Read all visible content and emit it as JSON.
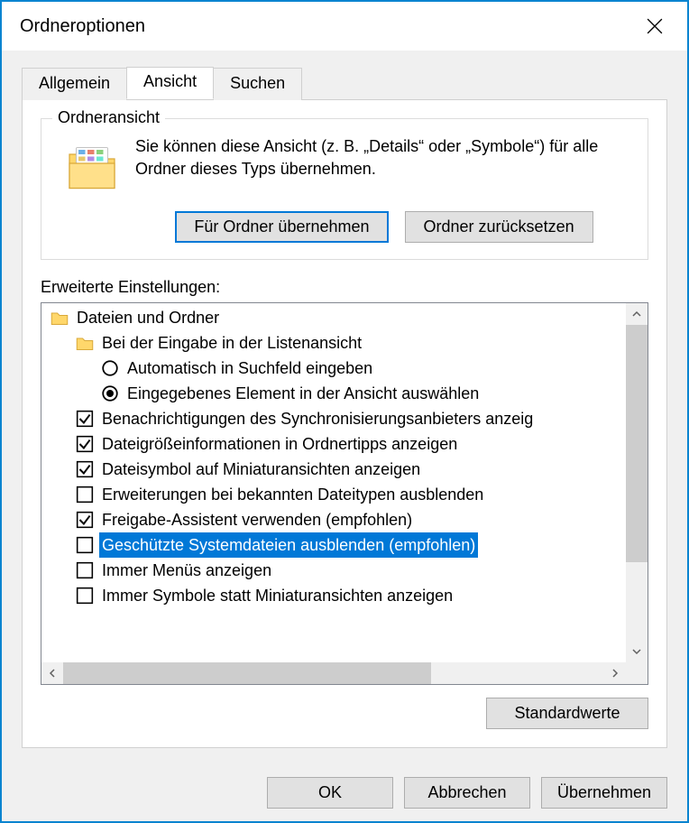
{
  "window": {
    "title": "Ordneroptionen"
  },
  "tabs": {
    "general": "Allgemein",
    "view": "Ansicht",
    "search": "Suchen"
  },
  "folderview": {
    "legend": "Ordneransicht",
    "desc": "Sie können diese Ansicht (z. B. „Details“ oder „Symbole“) für alle Ordner dieses Typs übernehmen.",
    "apply": "Für Ordner übernehmen",
    "reset": "Ordner zurücksetzen"
  },
  "advanced": {
    "label": "Erweiterte Einstellungen:",
    "root": "Dateien und Ordner",
    "typing_group": "Bei der Eingabe in der Listenansicht",
    "typing_auto": "Automatisch in Suchfeld eingeben",
    "typing_select": "Eingegebenes Element in der Ansicht auswählen",
    "sync_notif": "Benachrichtigungen des Synchronisierungsanbieters anzeig",
    "size_info": "Dateigrößeinformationen in Ordnertipps anzeigen",
    "icon_thumb": "Dateisymbol auf Miniaturansichten anzeigen",
    "hide_ext": "Erweiterungen bei bekannten Dateitypen ausblenden",
    "share_assist": "Freigabe-Assistent verwenden (empfohlen)",
    "hide_sys": "Geschützte Systemdateien ausblenden (empfohlen)",
    "always_menus": "Immer Menüs anzeigen",
    "always_icons": "Immer Symbole statt Miniaturansichten anzeigen"
  },
  "buttons": {
    "defaults": "Standardwerte",
    "ok": "OK",
    "cancel": "Abbrechen",
    "apply": "Übernehmen"
  }
}
